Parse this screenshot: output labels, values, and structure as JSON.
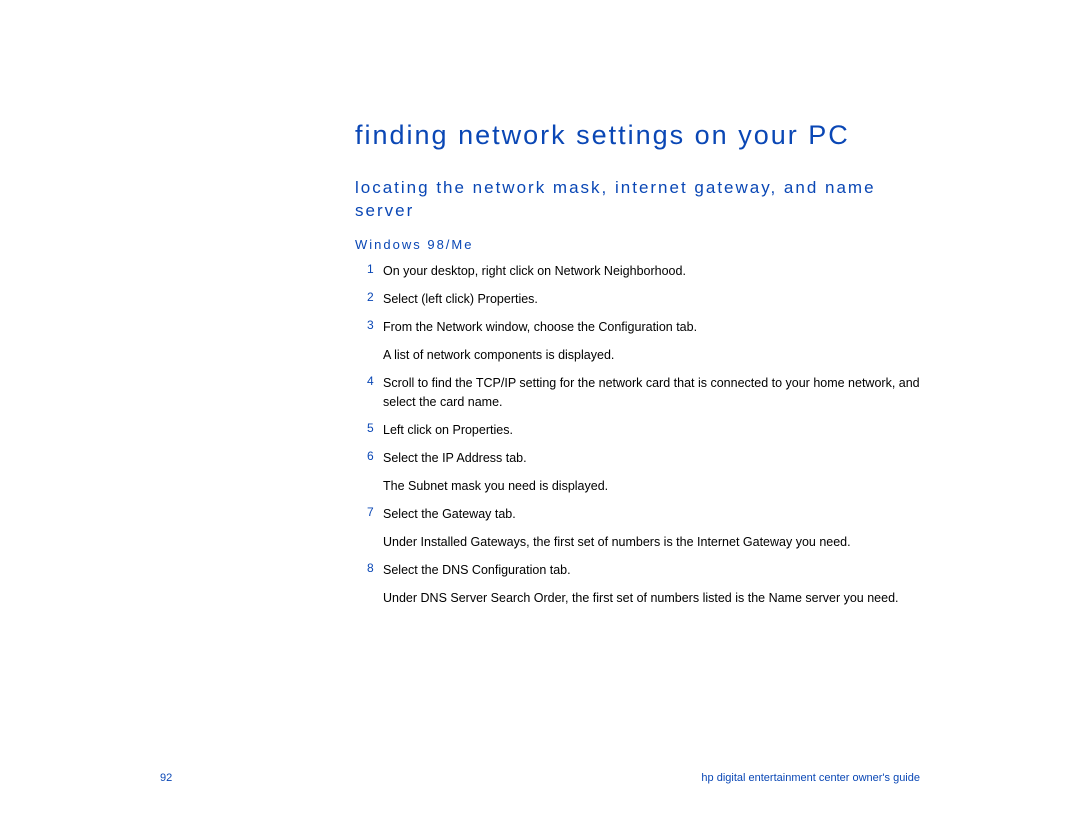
{
  "heading": "finding network settings on your PC",
  "subheading": "locating the network mask, internet gateway, and name server",
  "os_heading": "Windows 98/Me",
  "steps": [
    {
      "num": "1",
      "lines": [
        "On your desktop, right click on Network Neighborhood."
      ]
    },
    {
      "num": "2",
      "lines": [
        "Select (left click) Properties."
      ]
    },
    {
      "num": "3",
      "lines": [
        "From the Network window, choose the Configuration tab.",
        "A list of network components is displayed."
      ]
    },
    {
      "num": "4",
      "lines": [
        "Scroll to find the TCP/IP setting for the network card that is connected to your home network, and select the card name."
      ]
    },
    {
      "num": "5",
      "lines": [
        "Left click on Properties."
      ]
    },
    {
      "num": "6",
      "lines": [
        "Select the IP Address tab.",
        "The Subnet mask you need is displayed."
      ]
    },
    {
      "num": "7",
      "lines": [
        "Select the Gateway tab.",
        "Under Installed Gateways, the first set of numbers is the Internet Gateway you need."
      ]
    },
    {
      "num": "8",
      "lines": [
        "Select the DNS Configuration tab.",
        "Under DNS Server Search Order, the first set of numbers listed is the Name server you need."
      ]
    }
  ],
  "footer": {
    "page_number": "92",
    "guide": "hp digital entertainment center owner's guide"
  }
}
